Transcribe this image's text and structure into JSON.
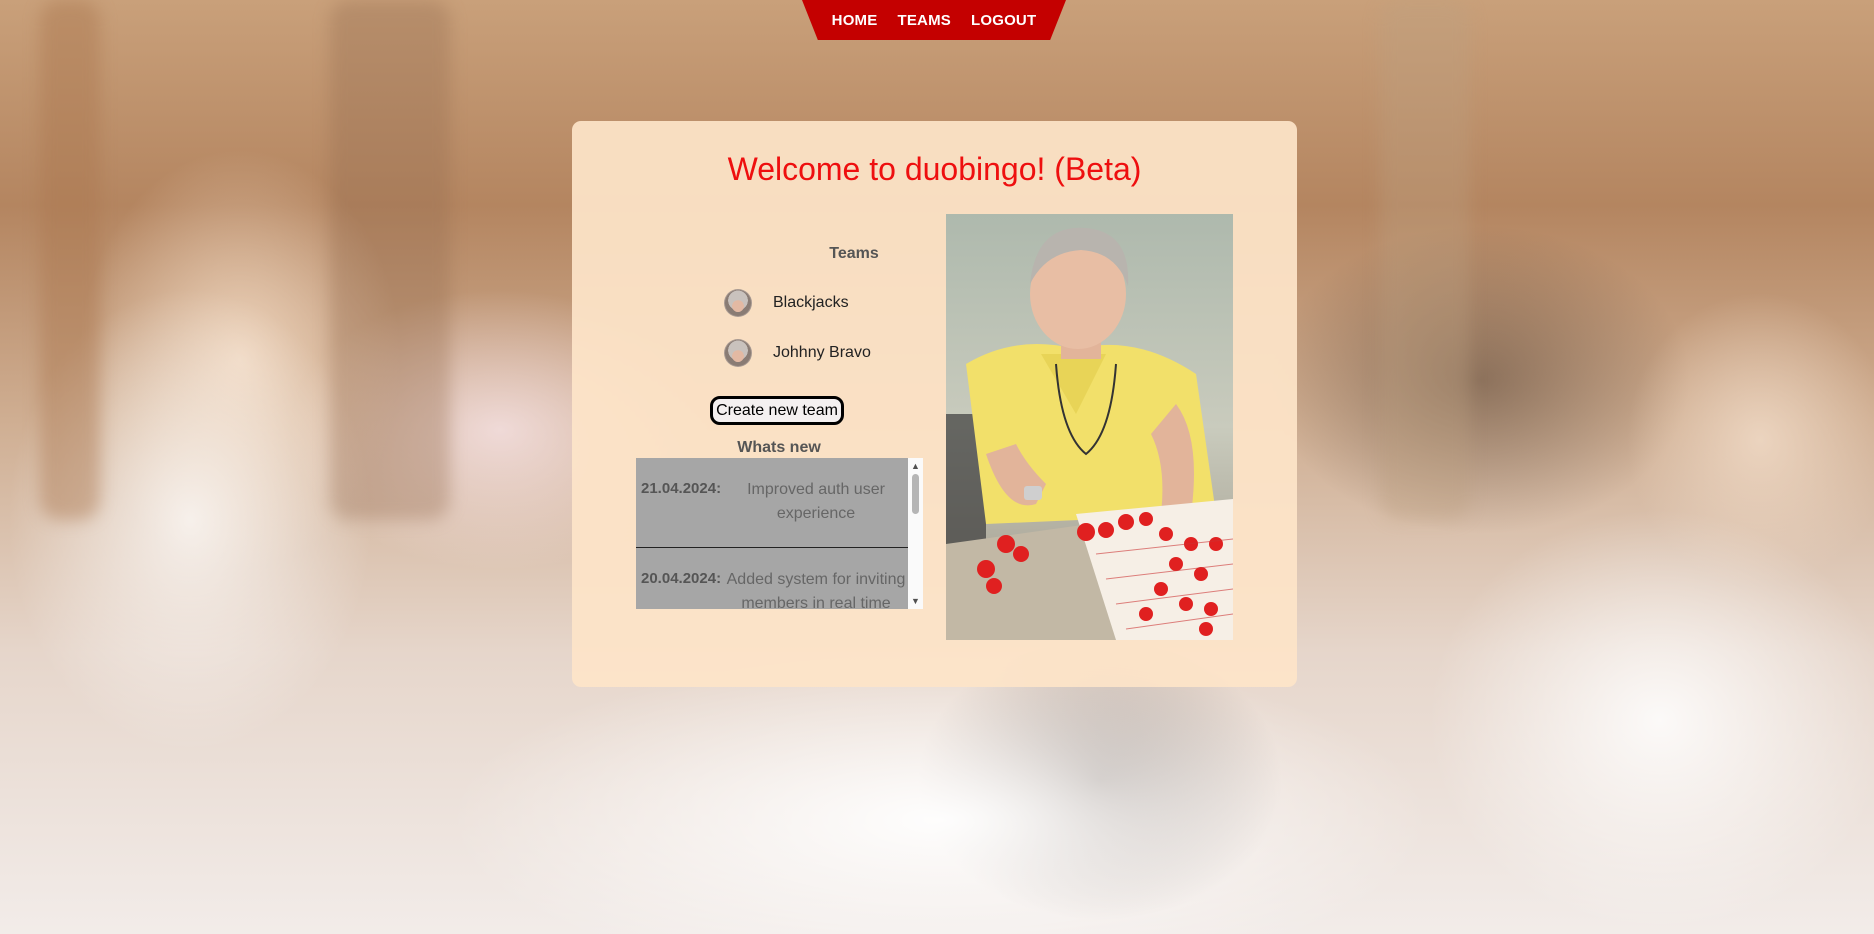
{
  "nav": {
    "items": [
      {
        "label": "HOME"
      },
      {
        "label": "TEAMS"
      },
      {
        "label": "LOGOUT"
      }
    ]
  },
  "main": {
    "title": "Welcome to duobingo! (Beta)"
  },
  "teams": {
    "heading": "Teams",
    "items": [
      {
        "name": "Blackjacks"
      },
      {
        "name": "Johhny Bravo"
      }
    ],
    "create_button": "Create new team"
  },
  "whats_new": {
    "heading": "Whats new",
    "items": [
      {
        "date": "21.04.2024:",
        "text": "Improved auth user experience"
      },
      {
        "date": "20.04.2024:",
        "text": "Added system for inviting members in real time"
      }
    ]
  },
  "colors": {
    "nav_bg": "#c40000",
    "title": "#ee0f0f",
    "card_bg": "#fde4c8",
    "news_bg": "#a6a6a6"
  },
  "icons": {
    "team_avatar": "elderly-person-avatar-icon"
  }
}
